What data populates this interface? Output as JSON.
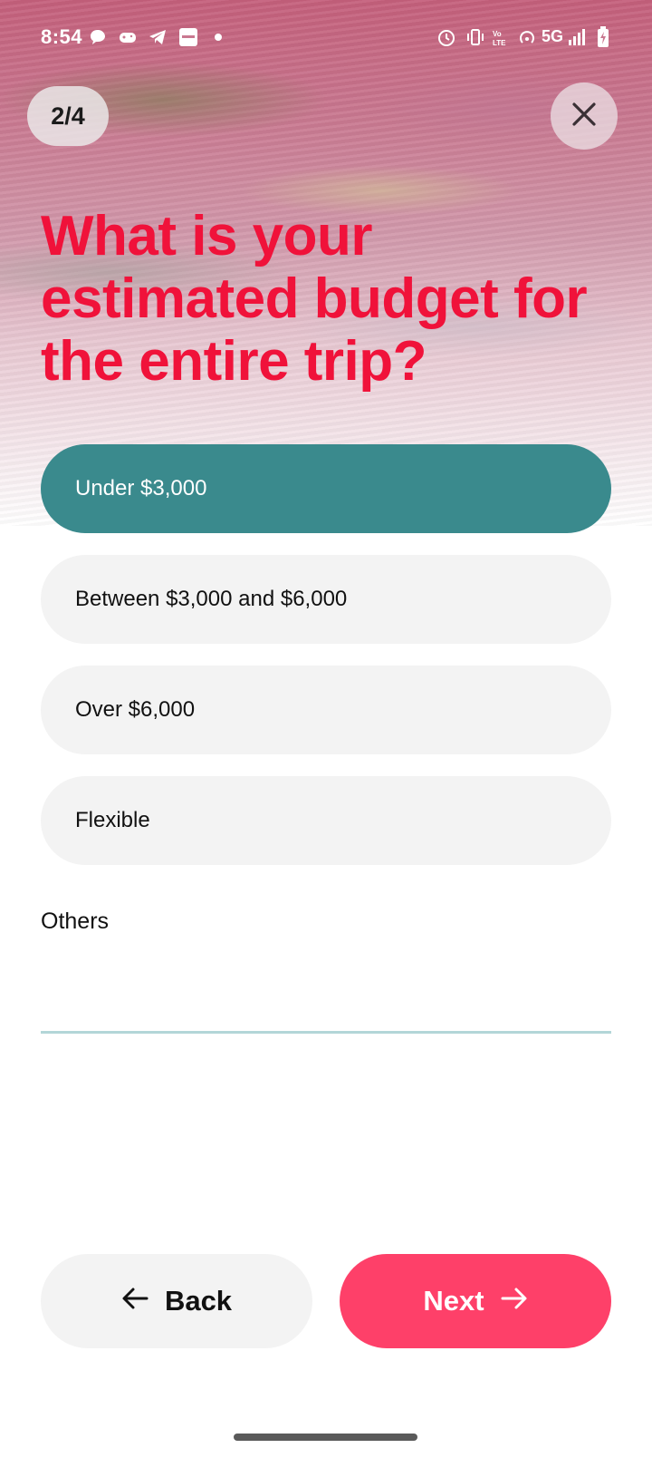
{
  "status_bar": {
    "time": "8:54",
    "network": "5G",
    "left_icons": [
      "chat-bubble-icon",
      "game-controller-icon",
      "telegram-icon",
      "paytm-icon",
      "dot-icon"
    ],
    "right_icons": [
      "alarm-icon",
      "vibrate-icon",
      "volte-icon",
      "hotspot-icon",
      "signal-icon",
      "battery-charging-icon"
    ]
  },
  "header": {
    "progress": "2/4",
    "close_icon": "close-icon"
  },
  "question": {
    "title": "What is your estimated budget for the entire trip?"
  },
  "options": [
    {
      "label": "Under $3,000",
      "selected": true
    },
    {
      "label": "Between $3,000 and $6,000",
      "selected": false
    },
    {
      "label": "Over $6,000",
      "selected": false
    },
    {
      "label": "Flexible",
      "selected": false
    }
  ],
  "others": {
    "label": "Others",
    "value": "",
    "placeholder": ""
  },
  "footer": {
    "back_label": "Back",
    "next_label": "Next"
  },
  "colors": {
    "title": "#f0123a",
    "selected_option": "#3a8a8d",
    "next_button": "#fe4069",
    "option_bg": "#f3f3f3",
    "input_underline": "#b3d6d8"
  }
}
